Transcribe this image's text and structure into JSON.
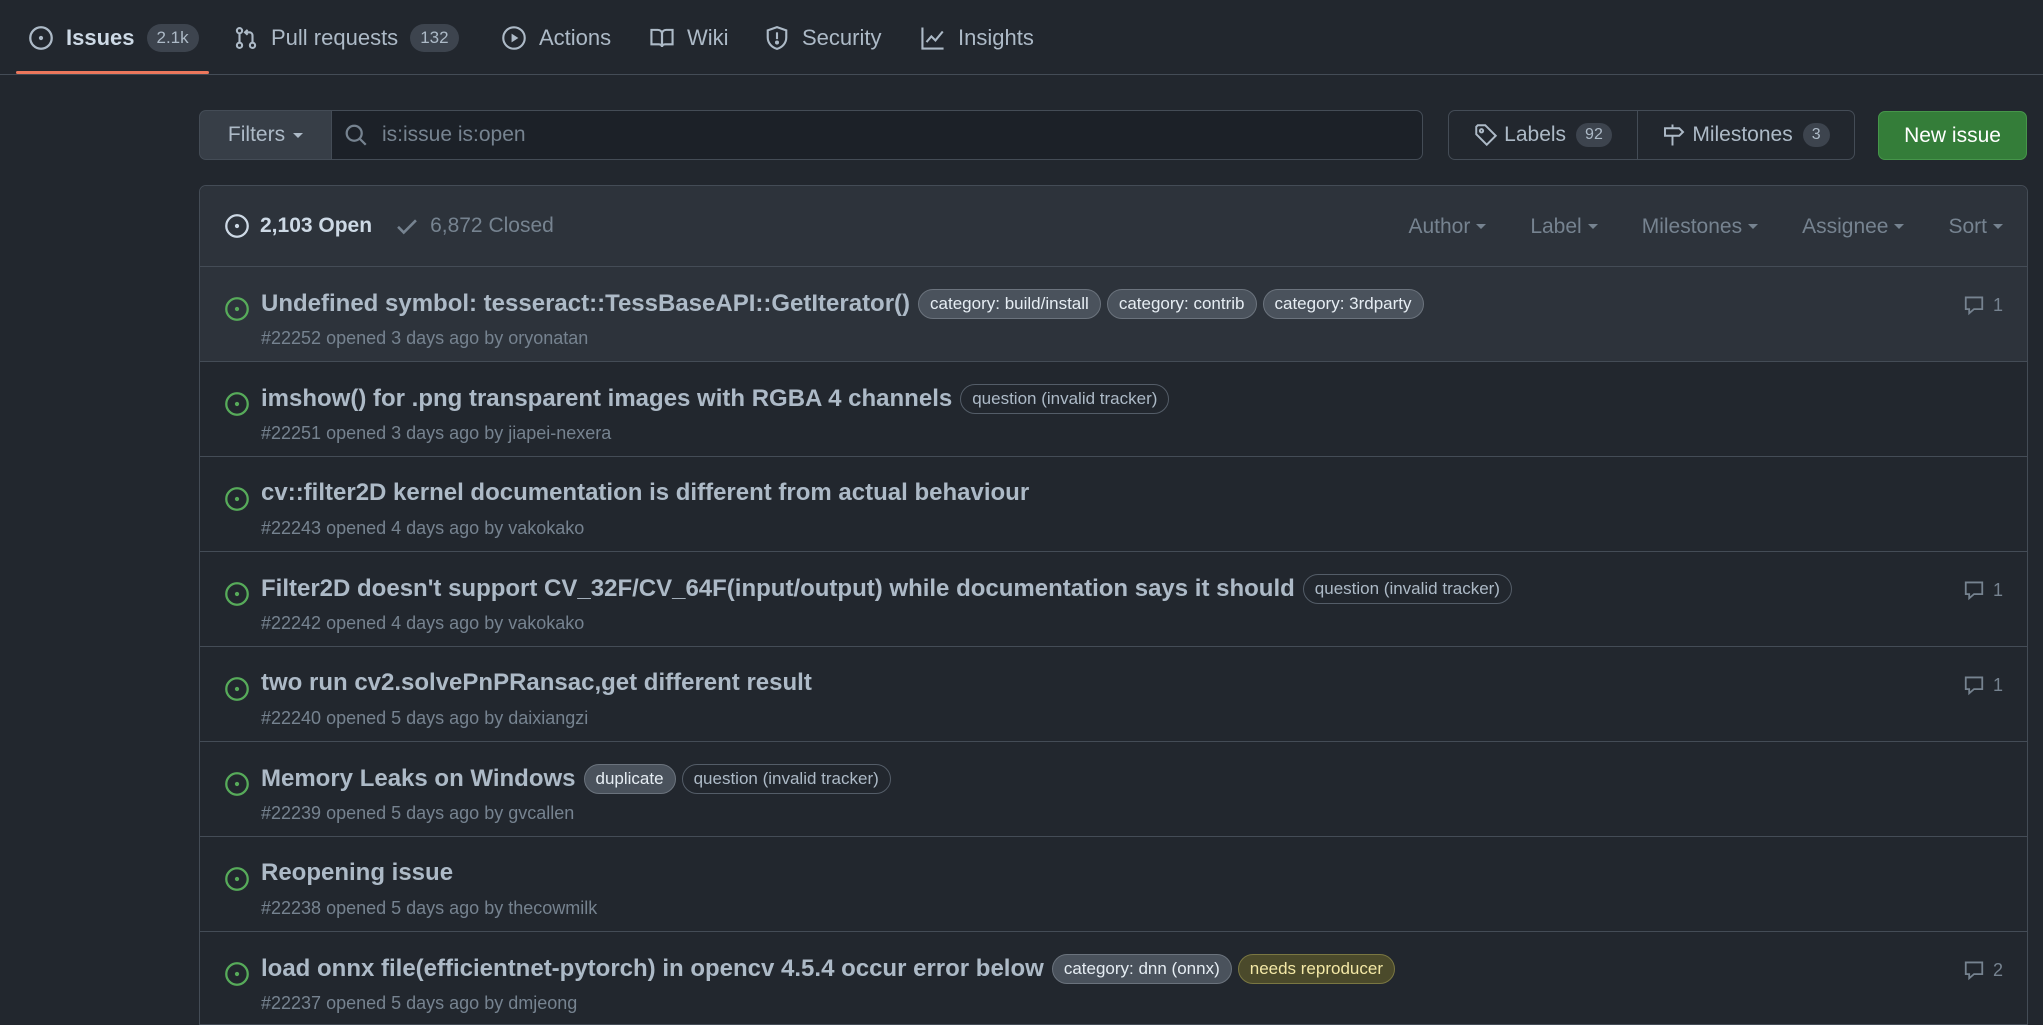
{
  "nav": {
    "items": [
      {
        "label": "Issues",
        "count": "2.1k",
        "icon": "issue-opened-icon"
      },
      {
        "label": "Pull requests",
        "count": "132",
        "icon": "git-pull-request-icon"
      },
      {
        "label": "Actions",
        "icon": "play-icon"
      },
      {
        "label": "Wiki",
        "icon": "book-icon"
      },
      {
        "label": "Security",
        "icon": "shield-icon"
      },
      {
        "label": "Insights",
        "icon": "graph-icon"
      }
    ]
  },
  "filters": {
    "button_label": "Filters",
    "search_value": "is:issue is:open"
  },
  "labels_btn": {
    "label": "Labels",
    "count": "92"
  },
  "milestones_btn": {
    "label": "Milestones",
    "count": "3"
  },
  "new_issue_label": "New issue",
  "header": {
    "open_label": "2,103 Open",
    "closed_label": "6,872 Closed",
    "filters": [
      "Author",
      "Label",
      "Milestones",
      "Assignee",
      "Sort"
    ]
  },
  "issues": [
    {
      "title": "Undefined symbol: tesseract::TessBaseAPI::GetIterator()",
      "labels": [
        {
          "text": "category: build/install",
          "style": "gray"
        },
        {
          "text": "category: contrib",
          "style": "gray"
        },
        {
          "text": "category: 3rdparty",
          "style": "gray"
        }
      ],
      "meta": "#22252 opened 3 days ago by oryonatan",
      "comments": "1"
    },
    {
      "title": "imshow() for .png transparent images with RGBA 4 channels",
      "labels": [
        {
          "text": "question (invalid tracker)",
          "style": "outline"
        }
      ],
      "meta": "#22251 opened 3 days ago by jiapei-nexera",
      "comments": ""
    },
    {
      "title": "cv::filter2D kernel documentation is different from actual behaviour",
      "labels": [],
      "meta": "#22243 opened 4 days ago by vakokako",
      "comments": ""
    },
    {
      "title": "Filter2D doesn't support CV_32F/CV_64F(input/output) while documentation says it should",
      "labels": [
        {
          "text": "question (invalid tracker)",
          "style": "outline"
        }
      ],
      "meta": "#22242 opened 4 days ago by vakokako",
      "comments": "1"
    },
    {
      "title": "two run cv2.solvePnPRansac,get different result",
      "labels": [],
      "meta": "#22240 opened 5 days ago by daixiangzi",
      "comments": "1"
    },
    {
      "title": "Memory Leaks on Windows",
      "labels": [
        {
          "text": "duplicate",
          "style": "gray"
        },
        {
          "text": "question (invalid tracker)",
          "style": "outline"
        }
      ],
      "meta": "#22239 opened 5 days ago by gvcallen",
      "comments": ""
    },
    {
      "title": "Reopening issue",
      "labels": [],
      "meta": "#22238 opened 5 days ago by thecowmilk",
      "comments": ""
    },
    {
      "title": "load onnx file(efficientnet-pytorch) in opencv 4.5.4 occur error below",
      "labels": [
        {
          "text": "category: dnn (onnx)",
          "style": "gray"
        },
        {
          "text": "needs reproducer",
          "style": "yellow"
        }
      ],
      "meta": "#22237 opened 5 days ago by dmjeong",
      "comments": "2"
    }
  ],
  "colors": {
    "background": "#22272e",
    "accent_underline": "#ec775c",
    "open_green": "#57ab5a",
    "new_issue_bg": "#347d39"
  }
}
